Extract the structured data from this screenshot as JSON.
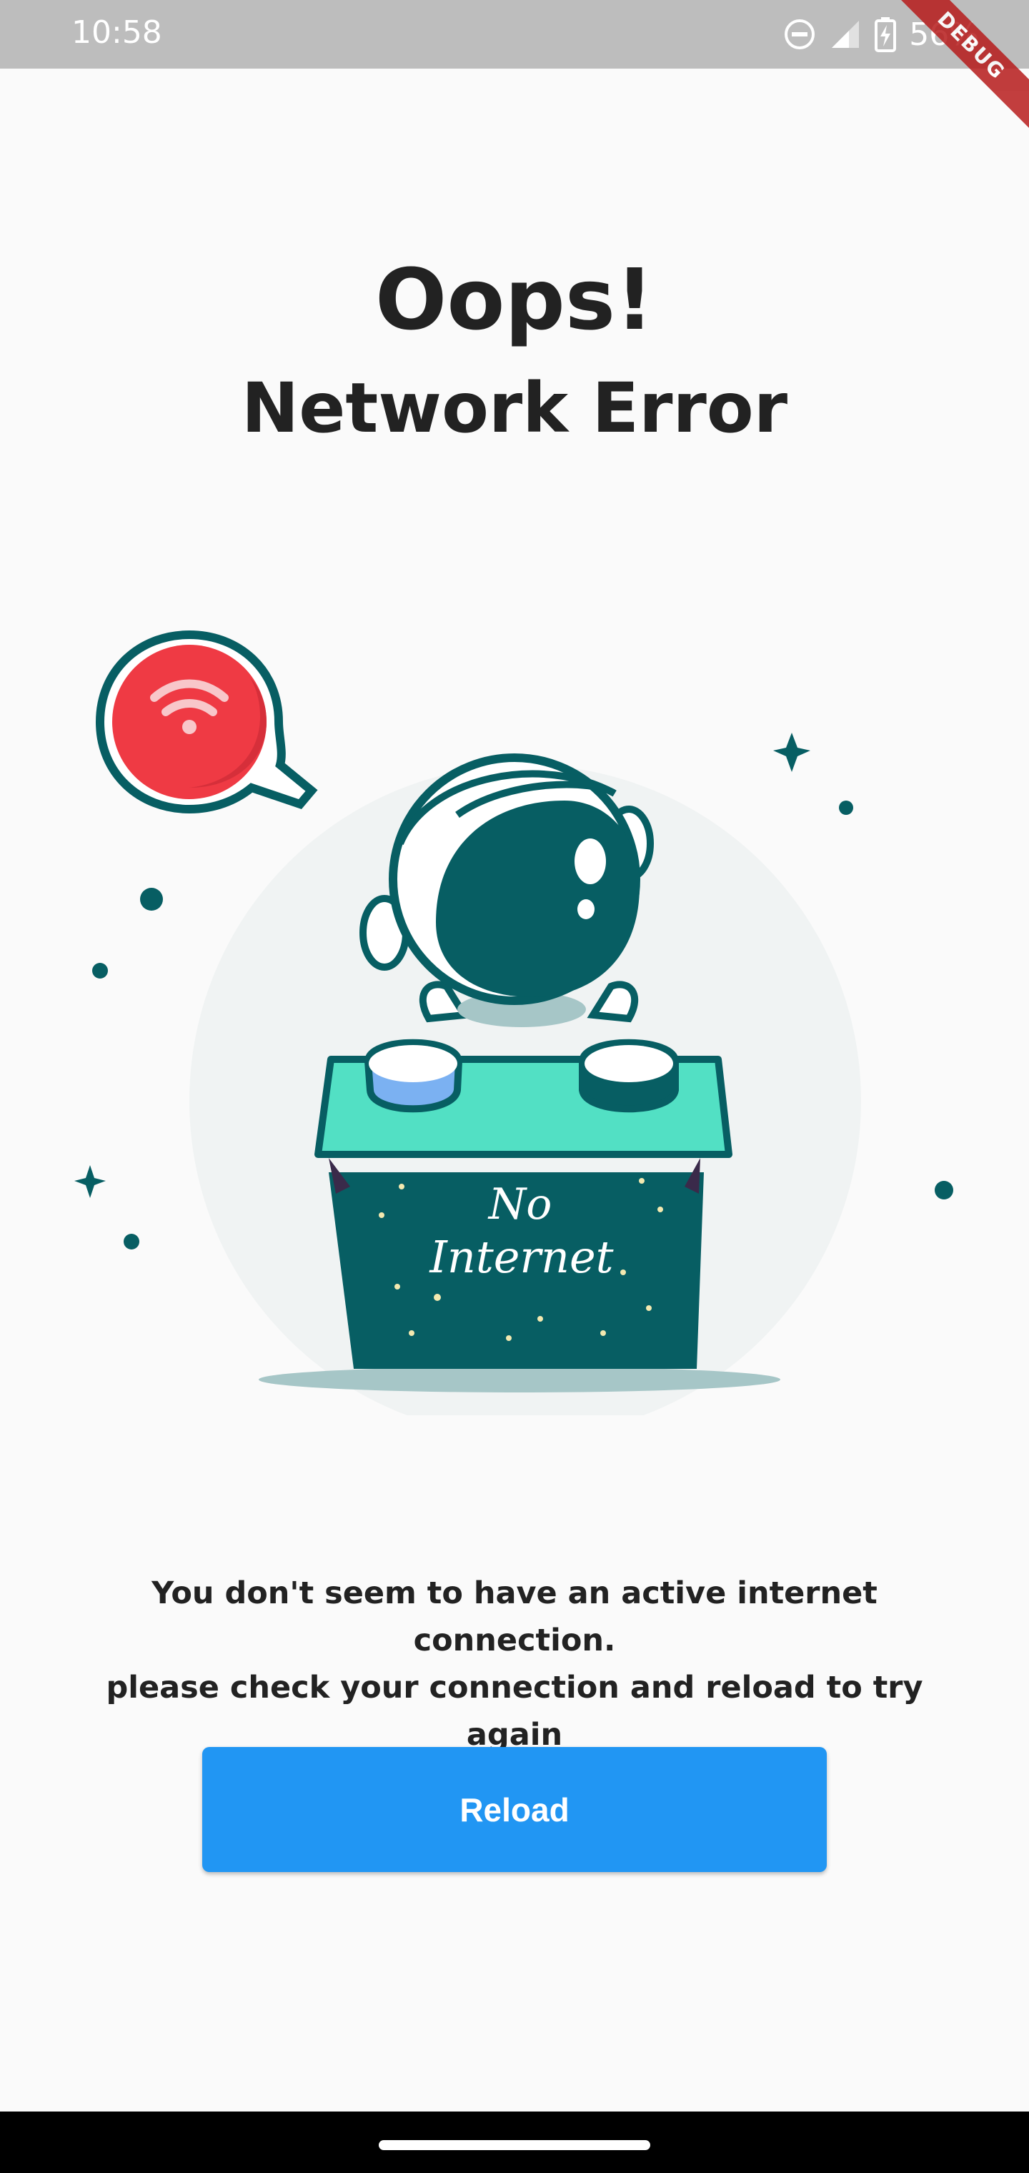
{
  "status_bar": {
    "time": "10:58",
    "battery_percent": "56%",
    "icons": [
      "do-not-disturb-icon",
      "signal-icon",
      "battery-charging-icon"
    ],
    "debug_banner": "DEBUG"
  },
  "heading": {
    "title": "Oops!",
    "subtitle": "Network Error"
  },
  "illustration": {
    "box_text_line1": "No",
    "box_text_line2": "Internet",
    "icon": "wifi-off-bubble-icon"
  },
  "message": {
    "line1": "You don't seem to have an active internet connection.",
    "line2": "please check your connection and reload to try again"
  },
  "actions": {
    "reload_label": "Reload"
  },
  "colors": {
    "accent": "#2196f3",
    "teal_dark": "#075e63",
    "teal_light": "#52e0c4",
    "alert_red": "#ef3a44",
    "background": "#fafafa"
  }
}
